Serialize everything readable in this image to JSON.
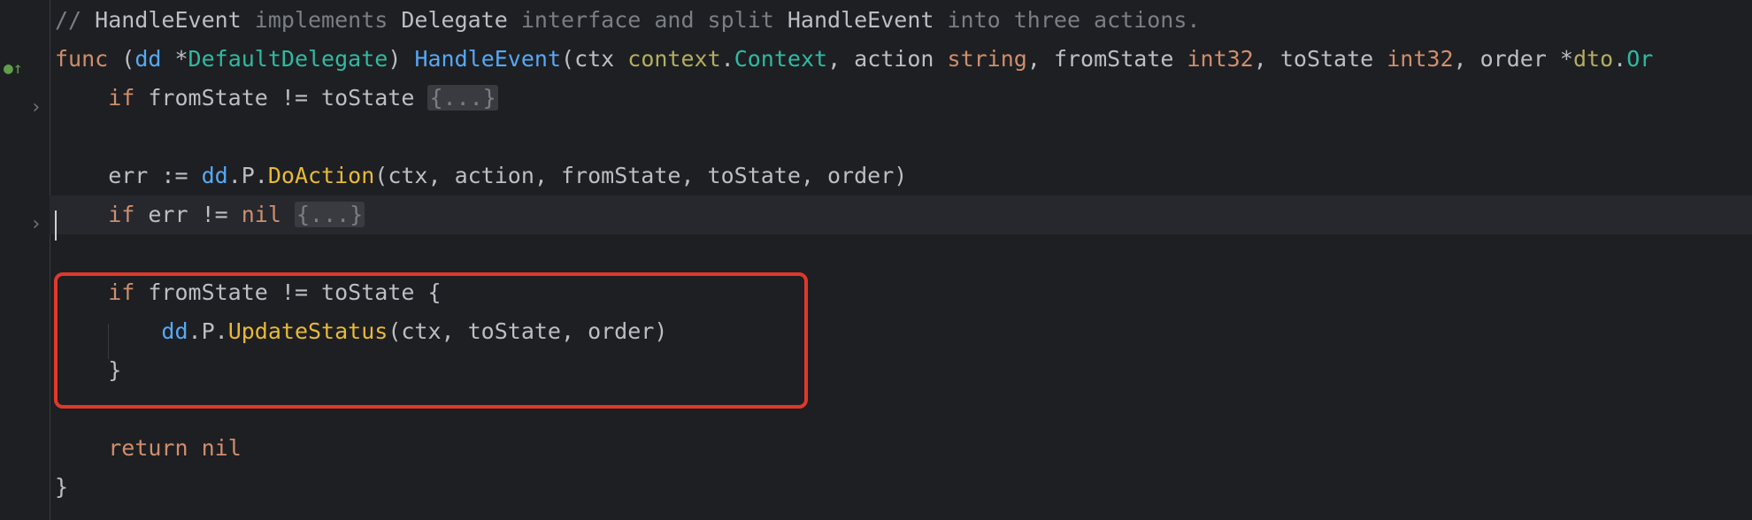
{
  "lines": [
    {
      "tokens": [
        {
          "t": "// ",
          "c": "c"
        },
        {
          "t": "HandleEvent",
          "c": "v"
        },
        {
          "t": " implements ",
          "c": "c"
        },
        {
          "t": "Delegate",
          "c": "v"
        },
        {
          "t": " interface and split ",
          "c": "c"
        },
        {
          "t": "HandleEvent",
          "c": "v"
        },
        {
          "t": " into three actions.",
          "c": "c"
        }
      ]
    },
    {
      "tokens": [
        {
          "t": "func",
          "c": "k"
        },
        {
          "t": " (",
          "c": "v"
        },
        {
          "t": "dd",
          "c": "f"
        },
        {
          "t": " *",
          "c": "v"
        },
        {
          "t": "DefaultDelegate",
          "c": "ty"
        },
        {
          "t": ") ",
          "c": "v"
        },
        {
          "t": "HandleEvent",
          "c": "f"
        },
        {
          "t": "(ctx ",
          "c": "v"
        },
        {
          "t": "context",
          "c": "pkg"
        },
        {
          "t": ".",
          "c": "v"
        },
        {
          "t": "Context",
          "c": "ty"
        },
        {
          "t": ", action ",
          "c": "v"
        },
        {
          "t": "string",
          "c": "k"
        },
        {
          "t": ", fromState ",
          "c": "v"
        },
        {
          "t": "int32",
          "c": "k"
        },
        {
          "t": ", toState ",
          "c": "v"
        },
        {
          "t": "int32",
          "c": "k"
        },
        {
          "t": ", order *",
          "c": "v"
        },
        {
          "t": "dto",
          "c": "pkg"
        },
        {
          "t": ".",
          "c": "v"
        },
        {
          "t": "Or",
          "c": "ty"
        }
      ]
    },
    {
      "tokens": [
        {
          "t": "    ",
          "c": "v"
        },
        {
          "t": "if",
          "c": "k"
        },
        {
          "t": " fromState != toState ",
          "c": "v"
        },
        {
          "t": "{...}",
          "c": "fold"
        }
      ]
    },
    {
      "tokens": []
    },
    {
      "tokens": [
        {
          "t": "    err := ",
          "c": "v"
        },
        {
          "t": "dd",
          "c": "f"
        },
        {
          "t": ".P.",
          "c": "v"
        },
        {
          "t": "DoAction",
          "c": "fn"
        },
        {
          "t": "(ctx, action, fromState, toState, order)",
          "c": "v"
        }
      ]
    },
    {
      "tokens": [
        {
          "t": "    ",
          "c": "v"
        },
        {
          "t": "if",
          "c": "k"
        },
        {
          "t": " err != ",
          "c": "v"
        },
        {
          "t": "nil",
          "c": "k"
        },
        {
          "t": " ",
          "c": "v"
        },
        {
          "t": "{...}",
          "c": "fold"
        }
      ]
    },
    {
      "tokens": []
    },
    {
      "tokens": [
        {
          "t": "    ",
          "c": "v"
        },
        {
          "t": "if",
          "c": "k"
        },
        {
          "t": " fromState != toState {",
          "c": "v"
        }
      ]
    },
    {
      "tokens": [
        {
          "t": "        ",
          "c": "v"
        },
        {
          "t": "dd",
          "c": "f"
        },
        {
          "t": ".P.",
          "c": "v"
        },
        {
          "t": "UpdateStatus",
          "c": "fn"
        },
        {
          "t": "(ctx, toState, order)",
          "c": "v"
        }
      ]
    },
    {
      "tokens": [
        {
          "t": "    }",
          "c": "v"
        }
      ]
    },
    {
      "tokens": []
    },
    {
      "tokens": [
        {
          "t": "    ",
          "c": "v"
        },
        {
          "t": "return",
          "c": "k"
        },
        {
          "t": " ",
          "c": "v"
        },
        {
          "t": "nil",
          "c": "k"
        }
      ]
    },
    {
      "tokens": [
        {
          "t": "}",
          "c": "v"
        }
      ]
    }
  ],
  "gutter": {
    "implements_icon": "implements-up-arrow-icon",
    "fold_icon": "chevron-right-icon",
    "implements_glyph": "●↑",
    "fold_glyph": "›"
  },
  "colors": {
    "background": "#1e1f22",
    "comment": "#7a7e85",
    "keyword": "#cf8e6d",
    "function": "#56a8f5",
    "method_call": "#e8ba36",
    "type": "#2fbaa3",
    "package": "#b3ae60",
    "highlight_box": "#e0382b"
  }
}
